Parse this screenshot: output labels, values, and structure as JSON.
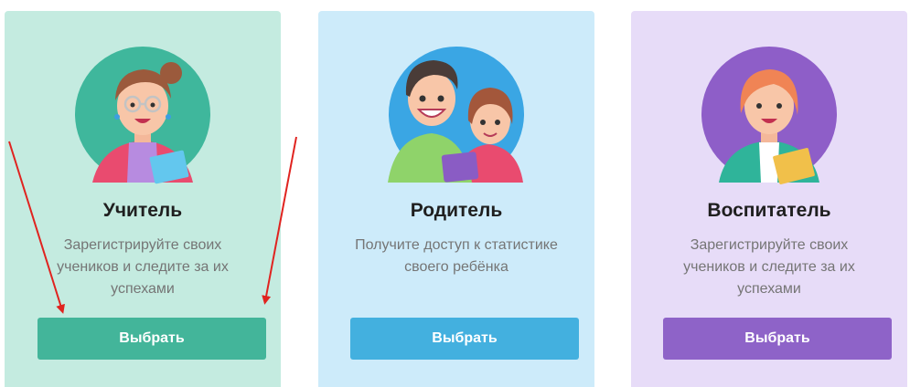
{
  "cards": [
    {
      "title": "Учитель",
      "desc_lines": [
        "Зарегистрируйте своих",
        "учеников и следите за их",
        "успехами"
      ],
      "button": "Выбрать",
      "accent": "#43b59a",
      "icon": "teacher-avatar"
    },
    {
      "title": "Родитель",
      "desc_lines": [
        "Получите доступ к статистике",
        "своего ребёнка"
      ],
      "button": "Выбрать",
      "accent": "#43b0df",
      "icon": "parents-avatar"
    },
    {
      "title": "Воспитатель",
      "desc_lines": [
        "Зарегистрируйте своих",
        "учеников и следите за их",
        "успехами"
      ],
      "button": "Выбрать",
      "accent": "#8e63c8",
      "icon": "educator-avatar"
    }
  ],
  "annotation_color": "#e0231f"
}
